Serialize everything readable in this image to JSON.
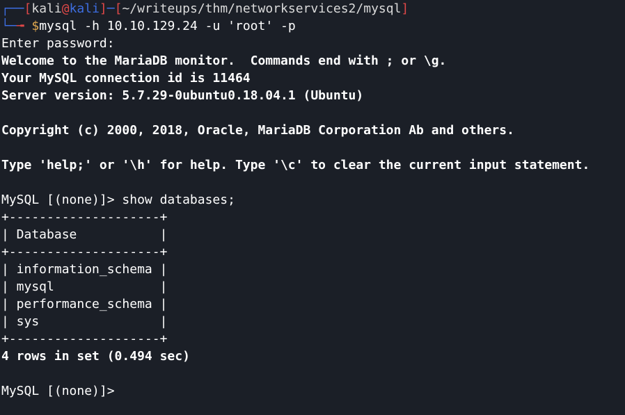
{
  "prompt": {
    "corner_top": "┌──",
    "bracket_open": "[",
    "user": "kali",
    "at": "@",
    "host": "kali",
    "bracket_close": "]",
    "dash": "─",
    "path_open": "[",
    "path": "~/writeups/thm/networkservices2/mysql",
    "path_close": "]",
    "corner_bottom": "└─",
    "dollar": "$",
    "command": "mysql -h 10.10.129.24 -u 'root' -p"
  },
  "output": {
    "line1": "Enter password:",
    "line2": "Welcome to the MariaDB monitor.  Commands end with ; or \\g.",
    "line3": "Your MySQL connection id is 11464",
    "line4": "Server version: 5.7.29-0ubuntu0.18.04.1 (Ubuntu)",
    "line5": "Copyright (c) 2000, 2018, Oracle, MariaDB Corporation Ab and others.",
    "line6": "Type 'help;' or '\\h' for help. Type '\\c' to clear the current input statement.",
    "query_prompt": "MySQL [(none)]> ",
    "query": "show databases;",
    "table_border": "+--------------------+",
    "table_header": "| Database           |",
    "rows": [
      "| information_schema |",
      "| mysql              |",
      "| performance_schema |",
      "| sys                |"
    ],
    "result_summary": "4 rows in set (0.494 sec)",
    "final_prompt": "MySQL [(none)]> "
  },
  "colors": {
    "background": "#1b1f27",
    "accent_blue": "#3d6de0",
    "accent_red": "#e04848",
    "prompt_gold": "#e0a84f"
  }
}
